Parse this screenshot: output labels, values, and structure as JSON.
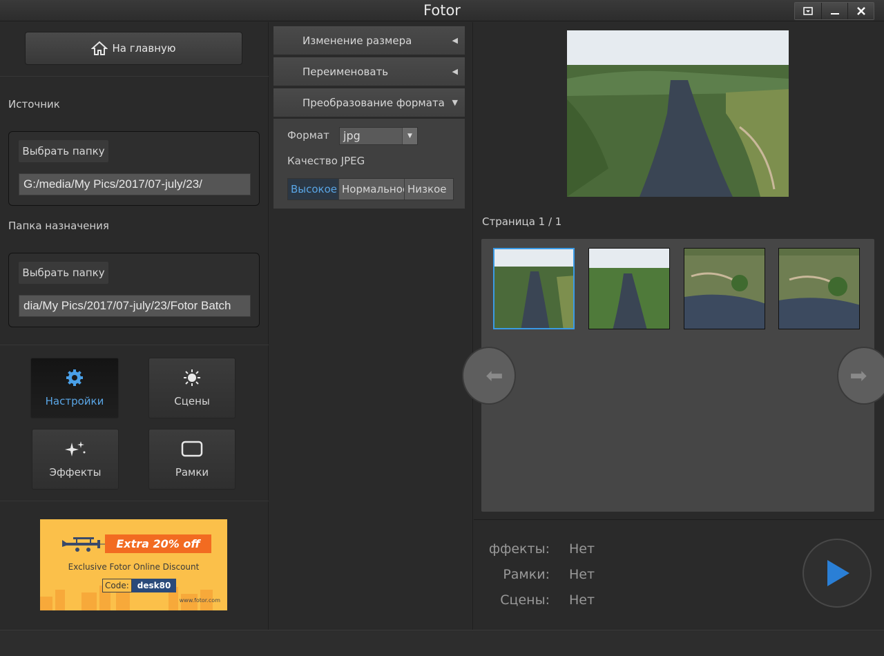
{
  "window": {
    "title": "Fotor"
  },
  "left": {
    "home_label": "На главную",
    "source_label": "Источник",
    "source_button": "Выбрать папку",
    "source_path": "G:/media/My Pics/2017/07-july/23/",
    "dest_label": "Папка назначения",
    "dest_button": "Выбрать папку",
    "dest_path": "dia/My Pics/2017/07-july/23/Fotor Batch",
    "tools": [
      {
        "label": "Настройки",
        "icon": "gear-icon",
        "active": true
      },
      {
        "label": "Сцены",
        "icon": "sun-icon",
        "active": false
      },
      {
        "label": "Эффекты",
        "icon": "sparkle-icon",
        "active": false
      },
      {
        "label": "Рамки",
        "icon": "frame-icon",
        "active": false
      }
    ],
    "ad": {
      "banner": "Extra 20% off",
      "subtitle": "Exclusive Fotor Online Discount",
      "code_label": "Code:",
      "code_value": "desk80",
      "url": "www.fotor.com"
    }
  },
  "middle": {
    "sections": [
      {
        "label": "Изменение размера",
        "expanded": false
      },
      {
        "label": "Переименовать",
        "expanded": false
      },
      {
        "label": "Преобразование формата",
        "expanded": true
      }
    ],
    "format_label": "Формат",
    "format_value": "jpg",
    "quality_label": "Качество JPEG",
    "quality_options": [
      "Высокое",
      "Нормальное",
      "Низкое"
    ],
    "quality_selected": "Высокое"
  },
  "right": {
    "page_label": "Страница  1 / 1",
    "info": [
      {
        "key": "ффекты:",
        "value": "Нет"
      },
      {
        "key": "Рамки:",
        "value": "Нет"
      },
      {
        "key": "Сцены:",
        "value": "Нет"
      }
    ]
  },
  "colors": {
    "accent": "#3a9be6",
    "ad_bg": "#fbc04a",
    "ad_banner": "#f26b21",
    "play": "#2a7fd6"
  }
}
